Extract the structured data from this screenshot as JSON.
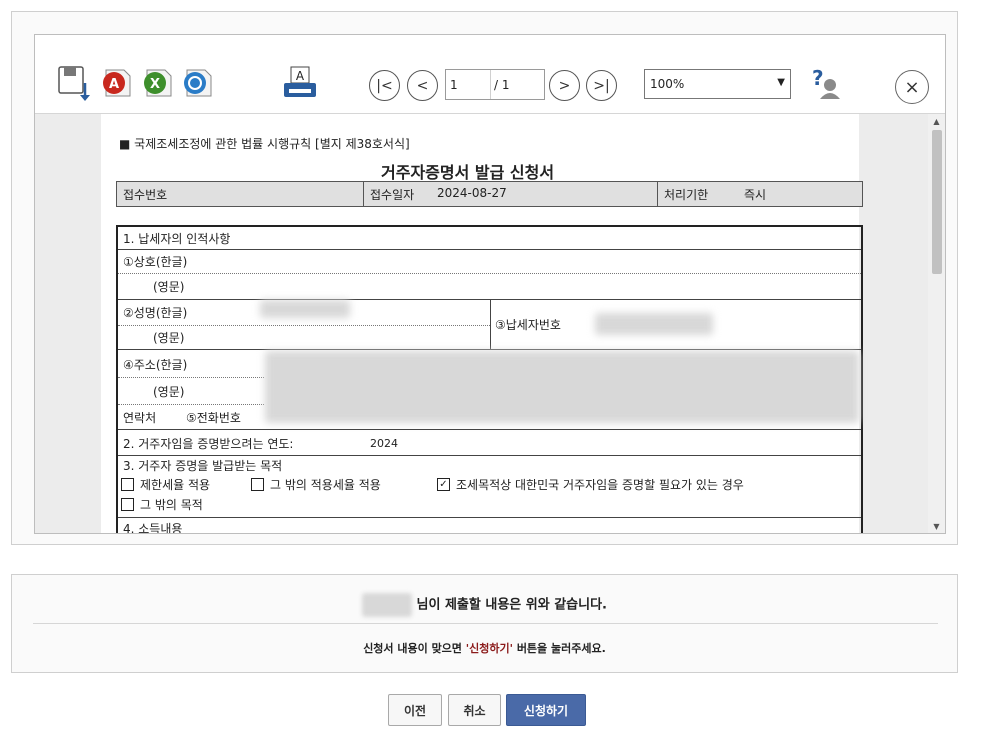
{
  "toolbar": {
    "icons": [
      "save-icon",
      "pdf-icon",
      "excel-icon",
      "hwp-icon",
      "print-icon",
      "help-icon"
    ],
    "nav": {
      "first": "|<",
      "prev": "<",
      "next": ">",
      "last": ">|"
    },
    "page_current": "1",
    "page_total": "/ 1",
    "zoom": "100%",
    "close_symbol": "×"
  },
  "form": {
    "regulation": "■ 국제조세조정에 관한 법률 시행규칙 [별지 제38호서식]",
    "title": "거주자증명서 발급 신청서",
    "receipt_no_label": "접수번호",
    "receipt_date_label": "접수일자",
    "receipt_date": "2024-08-27",
    "processing_label": "처리기한",
    "processing_value": "즉시",
    "section1": "1. 납세자의 인적사항",
    "firm_name_kr": "①상호(한글)",
    "firm_name_en": "(영문)",
    "name_kr": "②성명(한글)",
    "name_en": "(영문)",
    "taxpayer_no": "③납세자번호",
    "address_kr": "④주소(한글)",
    "address_en": "(영문)",
    "contact": "연락처",
    "phone": "⑤전화번호",
    "section2": "2. 거주자임을 증명받으려는 연도:",
    "year": "2024",
    "section3": "3. 거주자 증명을 발급받는 목적",
    "purpose1": "제한세율 적용",
    "purpose2": "그 밖의 적용세율 적용",
    "purpose3": "조세목적상 대한민국 거주자임을 증명할 필요가 있는 경우",
    "purpose4": "그 밖의 목적",
    "purpose3_check": "✓",
    "section4": "4. 소득내용"
  },
  "confirm": {
    "line1": "님이 제출할 내용은 위와 같습니다.",
    "line2_pre": "신청서 내용이 맞으면 ",
    "line2_highlight": "'신청하기'",
    "line2_post": " 버튼을 눌러주세요."
  },
  "buttons": {
    "prev": "이전",
    "cancel": "취소",
    "submit": "신청하기"
  },
  "colors": {
    "submit_bg": "#4a6aa8",
    "highlight": "#8b1a1a",
    "pdf": "#c8281e",
    "excel": "#3e8f2c",
    "hwp": "#2a7cc7"
  }
}
